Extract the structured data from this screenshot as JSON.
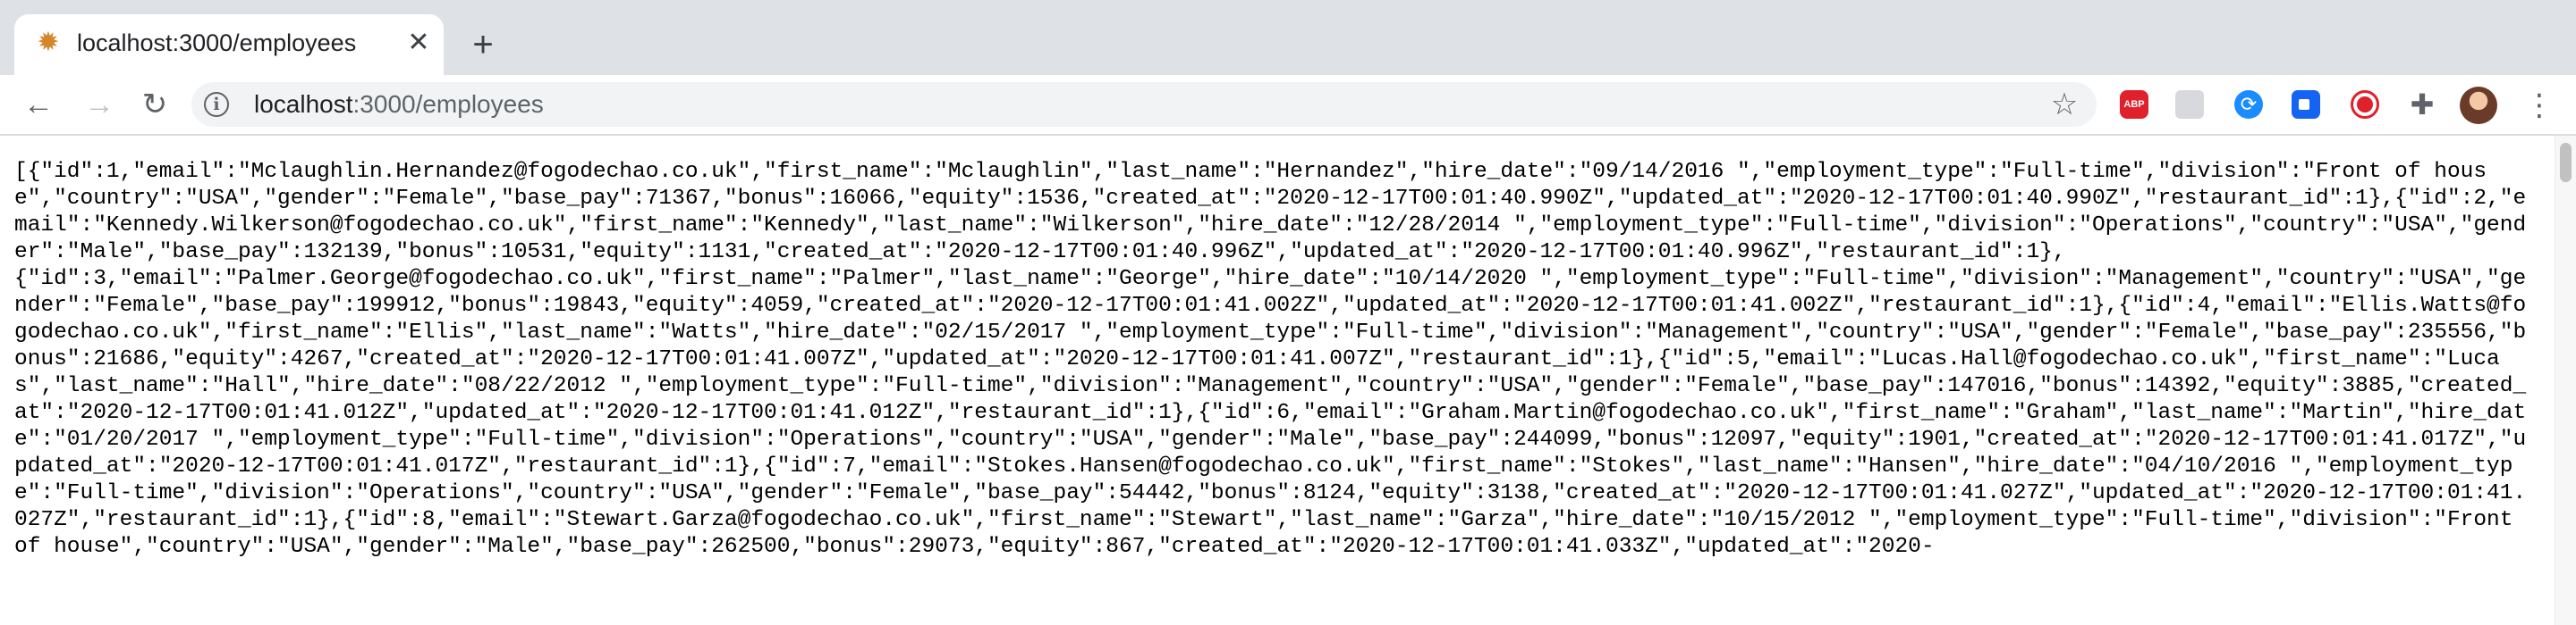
{
  "tab": {
    "title": "localhost:3000/employees",
    "favicon": "sun-favicon-icon",
    "close_glyph": "✕"
  },
  "new_tab_glyph": "+",
  "toolbar": {
    "back_glyph": "←",
    "forward_glyph": "→",
    "reload_glyph": "↻",
    "url_host": "localhost",
    "url_path": ":3000/employees",
    "star_glyph": "☆",
    "menu_glyph": "⋮"
  },
  "extensions": [
    {
      "name": "adblock-plus-icon",
      "label": "ABP"
    },
    {
      "name": "ghostery-icon"
    },
    {
      "name": "sync-icon"
    },
    {
      "name": "video-camera-icon"
    },
    {
      "name": "screen-recorder-icon"
    },
    {
      "name": "extensions-puzzle-icon"
    }
  ],
  "colors": {
    "tabstrip": "#dee1e6",
    "omnibox": "#f1f3f4",
    "text": "#000000"
  },
  "content": {
    "json_text": "[{\"id\":1,\"email\":\"Mclaughlin.Hernandez@fogodechao.co.uk\",\"first_name\":\"Mclaughlin\",\"last_name\":\"Hernandez\",\"hire_date\":\"09/14/2016 \",\"employment_type\":\"Full-time\",\"division\":\"Front of house\",\"country\":\"USA\",\"gender\":\"Female\",\"base_pay\":71367,\"bonus\":16066,\"equity\":1536,\"created_at\":\"2020-12-17T00:01:40.990Z\",\"updated_at\":\"2020-12-17T00:01:40.990Z\",\"restaurant_id\":1},{\"id\":2,\"email\":\"Kennedy.Wilkerson@fogodechao.co.uk\",\"first_name\":\"Kennedy\",\"last_name\":\"Wilkerson\",\"hire_date\":\"12/28/2014 \",\"employment_type\":\"Full-time\",\"division\":\"Operations\",\"country\":\"USA\",\"gender\":\"Male\",\"base_pay\":132139,\"bonus\":10531,\"equity\":1131,\"created_at\":\"2020-12-17T00:01:40.996Z\",\"updated_at\":\"2020-12-17T00:01:40.996Z\",\"restaurant_id\":1},\n{\"id\":3,\"email\":\"Palmer.George@fogodechao.co.uk\",\"first_name\":\"Palmer\",\"last_name\":\"George\",\"hire_date\":\"10/14/2020 \",\"employment_type\":\"Full-time\",\"division\":\"Management\",\"country\":\"USA\",\"gender\":\"Female\",\"base_pay\":199912,\"bonus\":19843,\"equity\":4059,\"created_at\":\"2020-12-17T00:01:41.002Z\",\"updated_at\":\"2020-12-17T00:01:41.002Z\",\"restaurant_id\":1},{\"id\":4,\"email\":\"Ellis.Watts@fogodechao.co.uk\",\"first_name\":\"Ellis\",\"last_name\":\"Watts\",\"hire_date\":\"02/15/2017 \",\"employment_type\":\"Full-time\",\"division\":\"Management\",\"country\":\"USA\",\"gender\":\"Female\",\"base_pay\":235556,\"bonus\":21686,\"equity\":4267,\"created_at\":\"2020-12-17T00:01:41.007Z\",\"updated_at\":\"2020-12-17T00:01:41.007Z\",\"restaurant_id\":1},{\"id\":5,\"email\":\"Lucas.Hall@fogodechao.co.uk\",\"first_name\":\"Lucas\",\"last_name\":\"Hall\",\"hire_date\":\"08/22/2012 \",\"employment_type\":\"Full-time\",\"division\":\"Management\",\"country\":\"USA\",\"gender\":\"Female\",\"base_pay\":147016,\"bonus\":14392,\"equity\":3885,\"created_at\":\"2020-12-17T00:01:41.012Z\",\"updated_at\":\"2020-12-17T00:01:41.012Z\",\"restaurant_id\":1},{\"id\":6,\"email\":\"Graham.Martin@fogodechao.co.uk\",\"first_name\":\"Graham\",\"last_name\":\"Martin\",\"hire_date\":\"01/20/2017 \",\"employment_type\":\"Full-time\",\"division\":\"Operations\",\"country\":\"USA\",\"gender\":\"Male\",\"base_pay\":244099,\"bonus\":12097,\"equity\":1901,\"created_at\":\"2020-12-17T00:01:41.017Z\",\"updated_at\":\"2020-12-17T00:01:41.017Z\",\"restaurant_id\":1},{\"id\":7,\"email\":\"Stokes.Hansen@fogodechao.co.uk\",\"first_name\":\"Stokes\",\"last_name\":\"Hansen\",\"hire_date\":\"04/10/2016 \",\"employment_type\":\"Full-time\",\"division\":\"Operations\",\"country\":\"USA\",\"gender\":\"Female\",\"base_pay\":54442,\"bonus\":8124,\"equity\":3138,\"created_at\":\"2020-12-17T00:01:41.027Z\",\"updated_at\":\"2020-12-17T00:01:41.027Z\",\"restaurant_id\":1},{\"id\":8,\"email\":\"Stewart.Garza@fogodechao.co.uk\",\"first_name\":\"Stewart\",\"last_name\":\"Garza\",\"hire_date\":\"10/15/2012 \",\"employment_type\":\"Full-time\",\"division\":\"Front of house\",\"country\":\"USA\",\"gender\":\"Male\",\"base_pay\":262500,\"bonus\":29073,\"equity\":867,\"created_at\":\"2020-12-17T00:01:41.033Z\",\"updated_at\":\"2020-"
  }
}
